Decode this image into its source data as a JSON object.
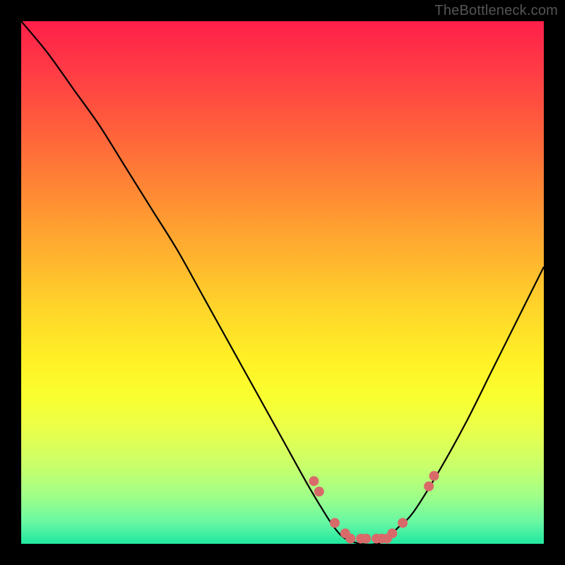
{
  "watermark": "TheBottleneck.com",
  "colors": {
    "frame_bg": "#000000",
    "dot": "#d96a6a",
    "curve": "#000000"
  },
  "chart_data": {
    "type": "line",
    "title": "",
    "xlabel": "",
    "ylabel": "",
    "xlim": [
      0,
      100
    ],
    "ylim": [
      0,
      100
    ],
    "grid": false,
    "legend": false,
    "series": [
      {
        "name": "bottleneck-curve",
        "x": [
          0,
          5,
          10,
          15,
          20,
          25,
          30,
          35,
          40,
          45,
          50,
          55,
          58,
          60,
          62,
          65,
          68,
          70,
          72,
          75,
          80,
          85,
          90,
          95,
          100
        ],
        "y": [
          100,
          94,
          87,
          80,
          72,
          64,
          56,
          47,
          38,
          29,
          20,
          11,
          6,
          3,
          1,
          0,
          0,
          1,
          3,
          6,
          14,
          23,
          33,
          43,
          53
        ]
      }
    ],
    "highlight_points": {
      "name": "near-zero-band",
      "x": [
        56,
        57,
        60,
        62,
        63,
        65,
        66,
        68,
        69,
        70,
        71,
        73,
        78,
        79
      ],
      "y": [
        12,
        10,
        4,
        2,
        1,
        1,
        1,
        1,
        1,
        1,
        2,
        4,
        11,
        13
      ]
    },
    "gradient_stops": [
      {
        "pos": 0,
        "color": "#ff1f4a"
      },
      {
        "pos": 22,
        "color": "#ff643a"
      },
      {
        "pos": 44,
        "color": "#ffb02f"
      },
      {
        "pos": 65,
        "color": "#fff126"
      },
      {
        "pos": 85,
        "color": "#c9ff6a"
      },
      {
        "pos": 100,
        "color": "#20e8a0"
      }
    ]
  }
}
